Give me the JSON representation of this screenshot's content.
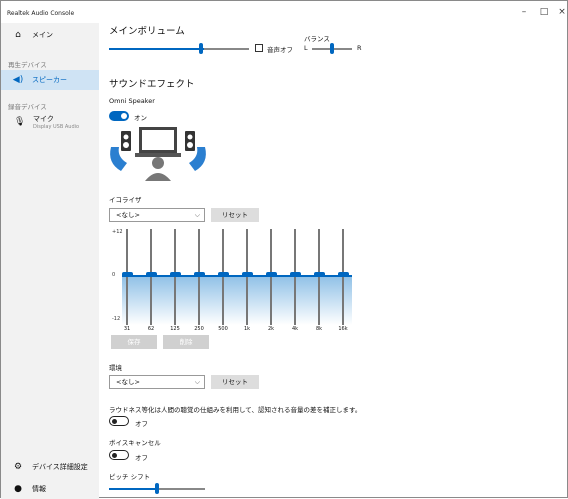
{
  "window": {
    "title": "Realtek Audio Console",
    "minimize": "–",
    "maximize": "□",
    "close": "×"
  },
  "sidebar": {
    "main_item": {
      "label": "メイン",
      "icon": "home-icon"
    },
    "playback_section": "再生デバイス",
    "speaker_item": {
      "label": "スピーカー",
      "icon": "speaker-icon"
    },
    "recording_section": "録音デバイス",
    "mic_item": {
      "label": "マイク",
      "sub": "Display USB Audio",
      "icon": "microphone-icon"
    },
    "device_settings": {
      "label": "デバイス詳細設定",
      "icon": "gear-icon"
    },
    "info": {
      "label": "情報",
      "icon": "info-icon"
    }
  },
  "main_volume": {
    "title": "メインボリューム",
    "level": 0.68,
    "mute_label": "音声オフ",
    "muted": false,
    "balance_label": "バランス",
    "balance_left": "L",
    "balance_right": "R",
    "balance_level": 0.5
  },
  "sound_effects": {
    "title": "サウンドエフェクト",
    "omni_label": "Omni Speaker",
    "omni_state": "オン"
  },
  "equalizer": {
    "title": "イコライザ",
    "preset": "<なし>",
    "reset_label": "リセット",
    "y_max": "+12",
    "y_zero": "0",
    "y_min": "-12",
    "bands": [
      "31",
      "62",
      "125",
      "250",
      "500",
      "1k",
      "2k",
      "4k",
      "8k",
      "16k"
    ],
    "gains": [
      0,
      0,
      0,
      0,
      0,
      0,
      0,
      0,
      0,
      0
    ],
    "save_label": "保存",
    "delete_label": "削除"
  },
  "environment": {
    "title": "環境",
    "preset": "<なし>",
    "reset_label": "リセット"
  },
  "loudness": {
    "description": "ラウドネス等化は人間の聴覚の仕組みを利用して、認知される音量の差を補正します。",
    "state": "オフ"
  },
  "voice_cancel": {
    "title": "ボイスキャンセル",
    "state": "オフ"
  },
  "pitch_shift": {
    "title": "ピッチ シフト",
    "level": 0.5
  }
}
